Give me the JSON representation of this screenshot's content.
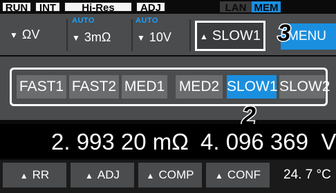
{
  "status_bar": {
    "tags": [
      "RUN",
      "INT",
      "Hi-Res",
      "ADJ",
      "LAN",
      "MEM"
    ]
  },
  "top_row": {
    "range_label": "ΩV",
    "auto_badge": "AUTO",
    "resistance_range": "3mΩ",
    "voltage_range": "10V",
    "speed_button": "SLOW1",
    "menu_button": "MENU",
    "callout": "3"
  },
  "speed_panel": {
    "options": [
      "FAST1",
      "FAST2",
      "MED1",
      "MED2",
      "SLOW1",
      "SLOW2"
    ],
    "selected": "SLOW1",
    "callout": "2"
  },
  "measurement": {
    "resistance": "2. 993 20 mΩ",
    "voltage": "4. 096 369  V"
  },
  "bottom_row": {
    "buttons": [
      "RR",
      "ADJ",
      "COMP",
      "CONF"
    ],
    "temperature": "24. 7 °C"
  },
  "colors": {
    "accent": "#1a8fe0",
    "panel": "#4a4c4e",
    "chip": "#6a6c6e",
    "background": "#0a0a0a"
  },
  "icons": {
    "dropdown": "triangle-down-icon",
    "expand": "triangle-up-icon"
  }
}
